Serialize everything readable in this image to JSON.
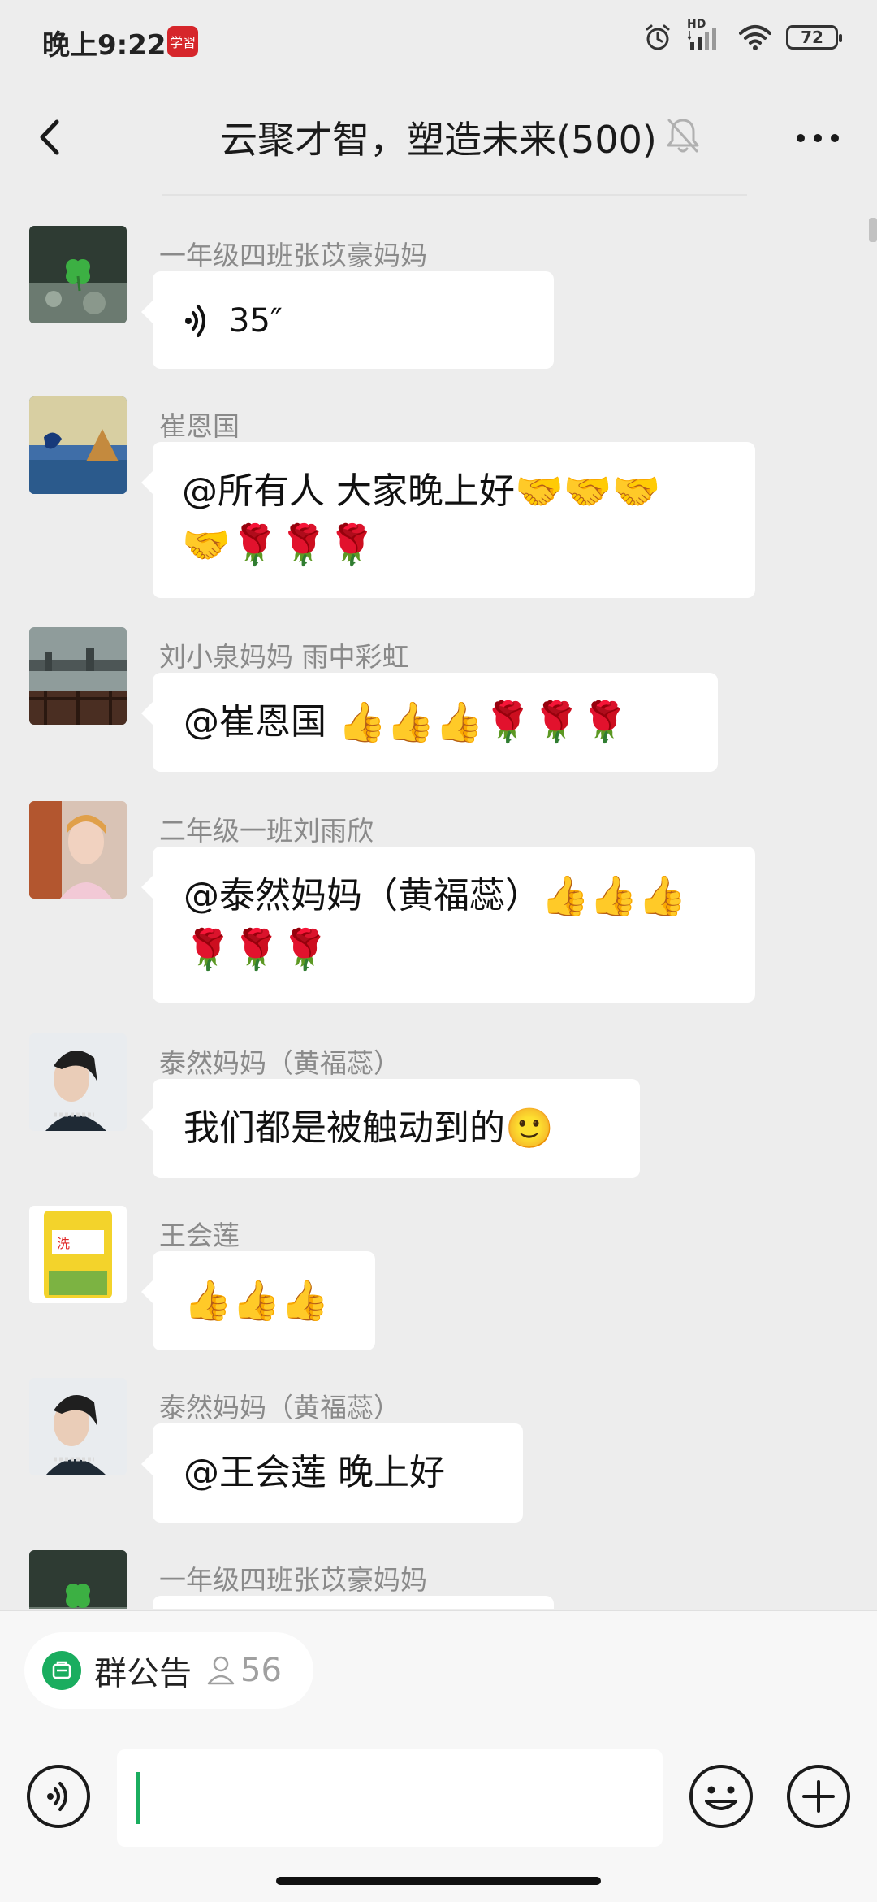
{
  "status_bar": {
    "time": "晚上9:22",
    "app_badge": "学習",
    "hd_label": "HD",
    "battery": "72",
    "icons": [
      "alarm-icon",
      "signal-icon",
      "wifi-icon",
      "battery-icon"
    ]
  },
  "header": {
    "title": "云聚才智，塑造未来(500)",
    "icons": [
      "back-arrow-icon",
      "mute-bell-icon",
      "more-dots-icon"
    ]
  },
  "messages": [
    {
      "sender": "一年级四班张苡豪妈妈",
      "type": "voice",
      "duration": "35″"
    },
    {
      "sender": "崔恩国",
      "line1": "@所有人  大家晚上好",
      "line1_emoji": "🤝🤝🤝",
      "line2_emoji": "🤝🌹🌹🌹"
    },
    {
      "sender": "刘小泉妈妈  雨中彩虹",
      "line1": "@崔恩国 ",
      "line1_emoji": "👍👍👍🌹🌹🌹"
    },
    {
      "sender": "二年级一班刘雨欣",
      "line1": "@泰然妈妈（黄福蕊）",
      "line1_emoji": "👍👍👍",
      "line2_emoji": "🌹🌹🌹"
    },
    {
      "sender": "泰然妈妈（黄福蕊）",
      "line1": "我们都是被触动到的",
      "line1_emoji": "🙂"
    },
    {
      "sender": "王会莲",
      "line1_emoji": "👍👍👍"
    },
    {
      "sender": "泰然妈妈（黄福蕊）",
      "line1": "@王会莲  晚上好"
    },
    {
      "sender": "一年级四班张苡豪妈妈"
    }
  ],
  "bottom": {
    "notice_label": "群公告",
    "member_count": "56",
    "icons": [
      "voice-input-icon",
      "emoji-icon",
      "plus-icon"
    ]
  },
  "colors": {
    "background": "#ededed",
    "bubble": "#ffffff",
    "accent_green": "#1aad5f",
    "sender_gray": "#8a8a8a"
  }
}
